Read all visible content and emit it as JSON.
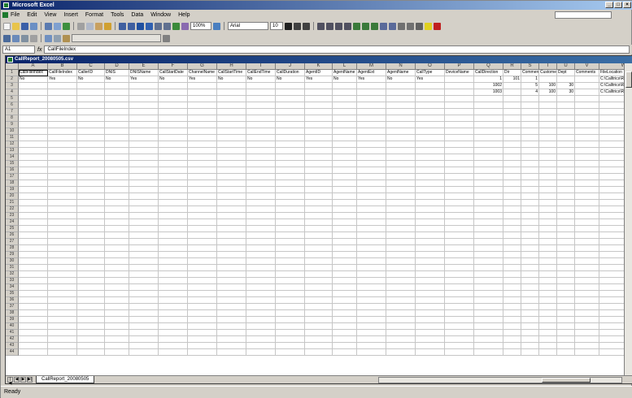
{
  "app": {
    "title": "Microsoft Excel",
    "window_buttons": [
      "_",
      "□",
      "×"
    ]
  },
  "menubar": {
    "items": [
      "File",
      "Edit",
      "View",
      "Insert",
      "Format",
      "Tools",
      "Data",
      "Window",
      "Help"
    ]
  },
  "toolbar": {
    "font_name": "Arial",
    "font_size": "10",
    "zoom": "100%"
  },
  "formula_bar": {
    "name_box": "A1",
    "formula": "CallFileIndex"
  },
  "workbook": {
    "title": "CallReport_20080505.csv"
  },
  "grid": {
    "columns": [
      "A",
      "B",
      "C",
      "D",
      "E",
      "F",
      "G",
      "H",
      "I",
      "J",
      "K",
      "L",
      "M",
      "N",
      "O",
      "P",
      "Q",
      "R",
      "S",
      "T",
      "U",
      "V",
      "W"
    ],
    "header_row": [
      "CallFileIndex",
      "CallFileIndex",
      "CallerID",
      "DNIS",
      "DNISName",
      "CallStartDate",
      "ChannelName",
      "CallStartTime",
      "CallEndTime",
      "CallDuration",
      "AgentID",
      "AgentName",
      "AgentExt",
      "AgentName",
      "CallType",
      "DeviceName",
      "CallDirection",
      "Dir",
      "Comment",
      "CustomerName",
      "Dept",
      "Comments",
      "FileLocation"
    ],
    "data_rows": [
      [
        "No",
        "Yes",
        "No",
        "No",
        "Yes",
        "No",
        "Yes",
        "No",
        "No",
        "No",
        "Yes",
        "No",
        "Yes",
        "No",
        "Yes",
        "",
        "1",
        "101",
        "1",
        "",
        "",
        "",
        "C:\\Calltrics\\Rec1"
      ],
      [
        "",
        "",
        "",
        "",
        "",
        "",
        "",
        "",
        "",
        "",
        "",
        "",
        "",
        "",
        "",
        "",
        "1002",
        "",
        "5",
        "100",
        "30",
        "",
        "C:\\Calltrics\\Rec2"
      ],
      [
        "",
        "",
        "",
        "",
        "",
        "",
        "",
        "",
        "",
        "",
        "",
        "",
        "",
        "",
        "",
        "",
        "1003",
        "",
        "4",
        "100",
        "30",
        "",
        "C:\\Calltrics\\Rec3"
      ]
    ],
    "row_count": 44
  },
  "sheet": {
    "tab": "CallReport_20080505",
    "nav": [
      "|◀",
      "◀",
      "▶",
      "▶|"
    ]
  },
  "status": {
    "text": "Ready"
  }
}
